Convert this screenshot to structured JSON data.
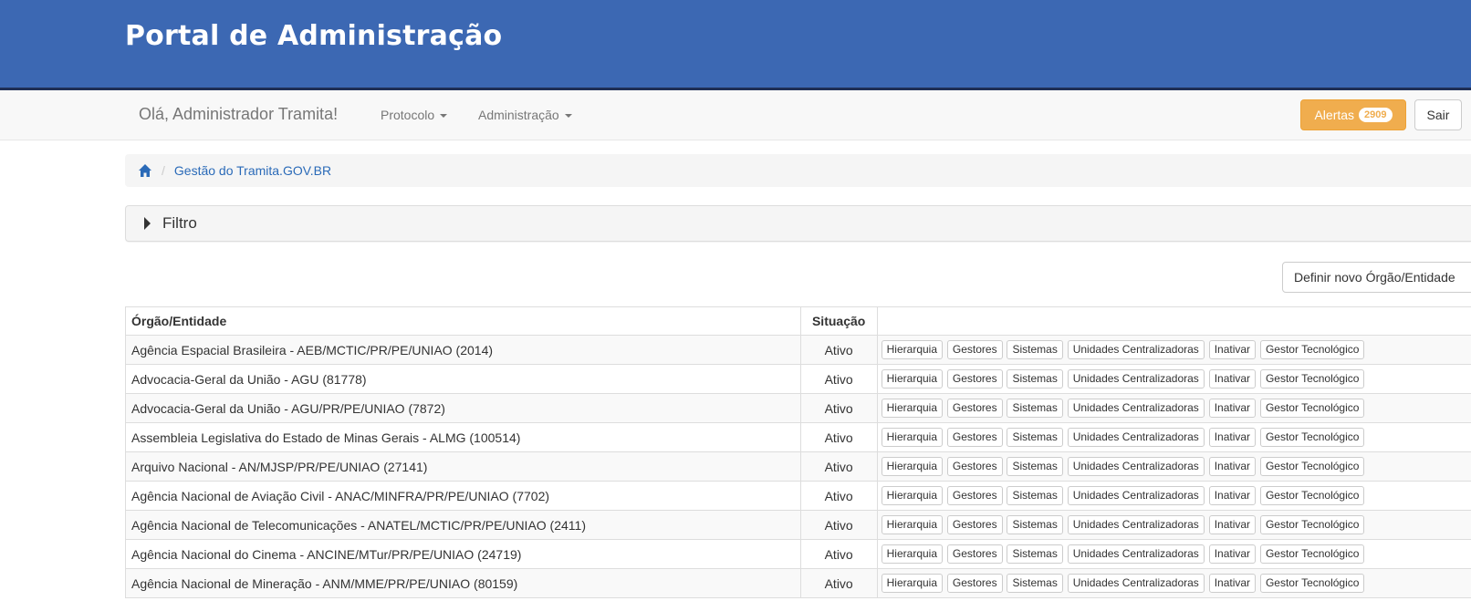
{
  "header": {
    "title": "Portal de Administração"
  },
  "navbar": {
    "greeting": "Olá, Administrador Tramita!",
    "menus": [
      "Protocolo",
      "Administração"
    ],
    "alerts_label": "Alertas",
    "alerts_count": "2909",
    "logout_label": "Sair"
  },
  "breadcrumb": {
    "home_icon": "home-icon",
    "current": "Gestão do Tramita.GOV.BR"
  },
  "filter": {
    "label": "Filtro"
  },
  "define_button": "Definir novo Órgão/Entidade",
  "table": {
    "headers": {
      "org": "Órgão/Entidade",
      "status": "Situação",
      "actions": ""
    },
    "action_labels": [
      "Hierarquia",
      "Gestores",
      "Sistemas",
      "Unidades Centralizadoras",
      "Inativar",
      "Gestor Tecnológico"
    ],
    "rows": [
      {
        "org": "Agência Espacial Brasileira - AEB/MCTIC/PR/PE/UNIAO (2014)",
        "status": "Ativo"
      },
      {
        "org": "Advocacia-Geral da União - AGU (81778)",
        "status": "Ativo"
      },
      {
        "org": "Advocacia-Geral da União - AGU/PR/PE/UNIAO (7872)",
        "status": "Ativo"
      },
      {
        "org": "Assembleia Legislativa do Estado de Minas Gerais - ALMG (100514)",
        "status": "Ativo"
      },
      {
        "org": "Arquivo Nacional - AN/MJSP/PR/PE/UNIAO (27141)",
        "status": "Ativo"
      },
      {
        "org": "Agência Nacional de Aviação Civil - ANAC/MINFRA/PR/PE/UNIAO (7702)",
        "status": "Ativo"
      },
      {
        "org": "Agência Nacional de Telecomunicações - ANATEL/MCTIC/PR/PE/UNIAO (2411)",
        "status": "Ativo"
      },
      {
        "org": "Agência Nacional do Cinema - ANCINE/MTur/PR/PE/UNIAO (24719)",
        "status": "Ativo"
      },
      {
        "org": "Agência Nacional de Mineração - ANM/MME/PR/PE/UNIAO (80159)",
        "status": "Ativo"
      }
    ]
  },
  "colors": {
    "banner": "#3c68b3",
    "alerts": "#f0ad4e",
    "link": "#2a6ab8"
  }
}
